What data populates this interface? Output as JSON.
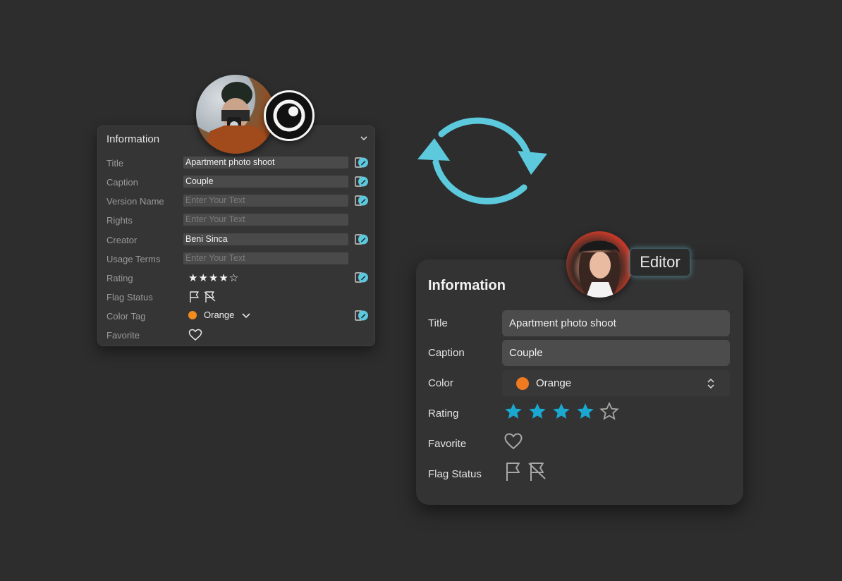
{
  "left_panel": {
    "header": "Information",
    "rows": [
      {
        "label": "Title",
        "value": "Apartment photo shoot",
        "placeholder": false
      },
      {
        "label": "Caption",
        "value": "Couple",
        "placeholder": false
      },
      {
        "label": "Version Name",
        "value": "Enter Your Text",
        "placeholder": true
      },
      {
        "label": "Rights",
        "value": "Enter Your Text",
        "placeholder": true
      },
      {
        "label": "Creator",
        "value": "Beni Sinca",
        "placeholder": false
      },
      {
        "label": "Usage Terms",
        "value": "Enter Your Text",
        "placeholder": true
      }
    ],
    "rating_label": "Rating",
    "rating_stars": "★★★★☆",
    "rating_value": 4,
    "flag_label": "Flag Status",
    "color_label": "Color Tag",
    "color_value": "Orange",
    "favorite_label": "Favorite"
  },
  "editor_tag": "Editor",
  "right_panel": {
    "title": "Information",
    "title_label": "Title",
    "title_value": "Apartment photo shoot",
    "caption_label": "Caption",
    "caption_value": "Couple",
    "color_label": "Color",
    "color_value": "Orange",
    "rating_label": "Rating",
    "rating_value": 4,
    "rating_max": 5,
    "favorite_label": "Favorite",
    "flag_label": "Flag Status"
  },
  "colors": {
    "accent": "#5cc9dd",
    "star_filled": "#1aa7d0",
    "orange": "#f07a1f",
    "background": "#2d2d2d"
  }
}
